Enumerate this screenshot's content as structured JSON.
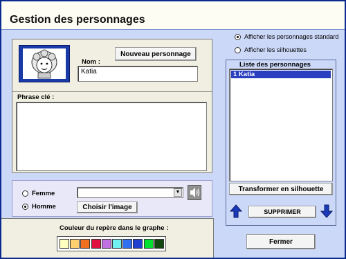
{
  "window": {
    "title": "Gestion des personnages"
  },
  "character": {
    "nom_label": "Nom :",
    "nom_value": "Katia",
    "new_button": "Nouveau personnage",
    "phrase_label": "Phrase clé :",
    "phrase_value": ""
  },
  "gender": {
    "femme": "Femme",
    "homme": "Homme",
    "selected": "Homme",
    "image_select_value": "",
    "choose_image_button": "Choisir l'image"
  },
  "color_section": {
    "label": "Couleur du repère dans le graphe :",
    "colors": [
      "#ffffc0",
      "#ffd070",
      "#f07020",
      "#e01040",
      "#c070e0",
      "#70f0f0",
      "#3070f0",
      "#2040d0",
      "#00e030",
      "#104810"
    ]
  },
  "options": {
    "standard": "Afficher les personnages standard",
    "silhouettes": "Afficher les silhouettes",
    "selected": "standard"
  },
  "list": {
    "title": "Liste des personnages",
    "items": [
      {
        "label": "1 Katia",
        "selected": true
      }
    ],
    "transform_button": "Transformer en silhouette",
    "delete_button": "SUPPRIMER"
  },
  "close_button": "Fermer"
}
